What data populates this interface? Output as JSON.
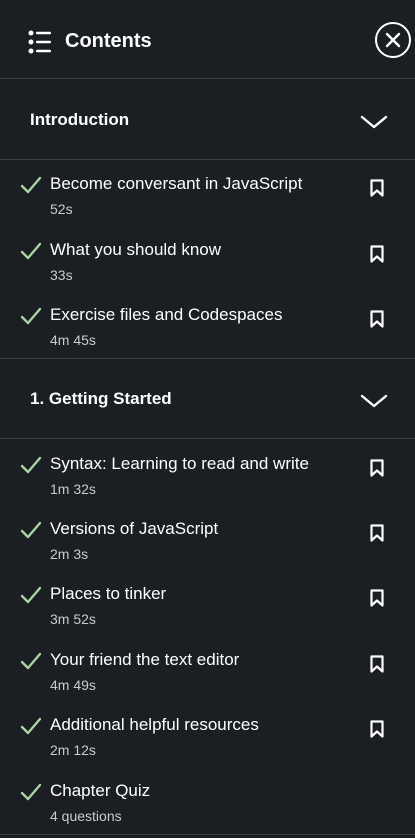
{
  "header": {
    "title": "Contents"
  },
  "sections": [
    {
      "title": "Introduction",
      "items": [
        {
          "title": "Become conversant in JavaScript",
          "sub": "52s"
        },
        {
          "title": "What you should know",
          "sub": "33s"
        },
        {
          "title": "Exercise files and Codespaces",
          "sub": "4m 45s"
        }
      ]
    },
    {
      "title": "1. Getting Started",
      "items": [
        {
          "title": "Syntax: Learning to read and write",
          "sub": "1m 32s"
        },
        {
          "title": "Versions of JavaScript",
          "sub": "2m 3s"
        },
        {
          "title": "Places to tinker",
          "sub": "3m 52s"
        },
        {
          "title": "Your friend the text editor",
          "sub": "4m 49s"
        },
        {
          "title": "Additional helpful resources",
          "sub": "2m 12s"
        },
        {
          "title": "Chapter Quiz",
          "sub": "4 questions"
        }
      ]
    }
  ],
  "colors": {
    "background": "#1b1f23",
    "check": "#a8d5a2",
    "divider": "#3a3f45",
    "subtext": "#c7cbd0"
  }
}
